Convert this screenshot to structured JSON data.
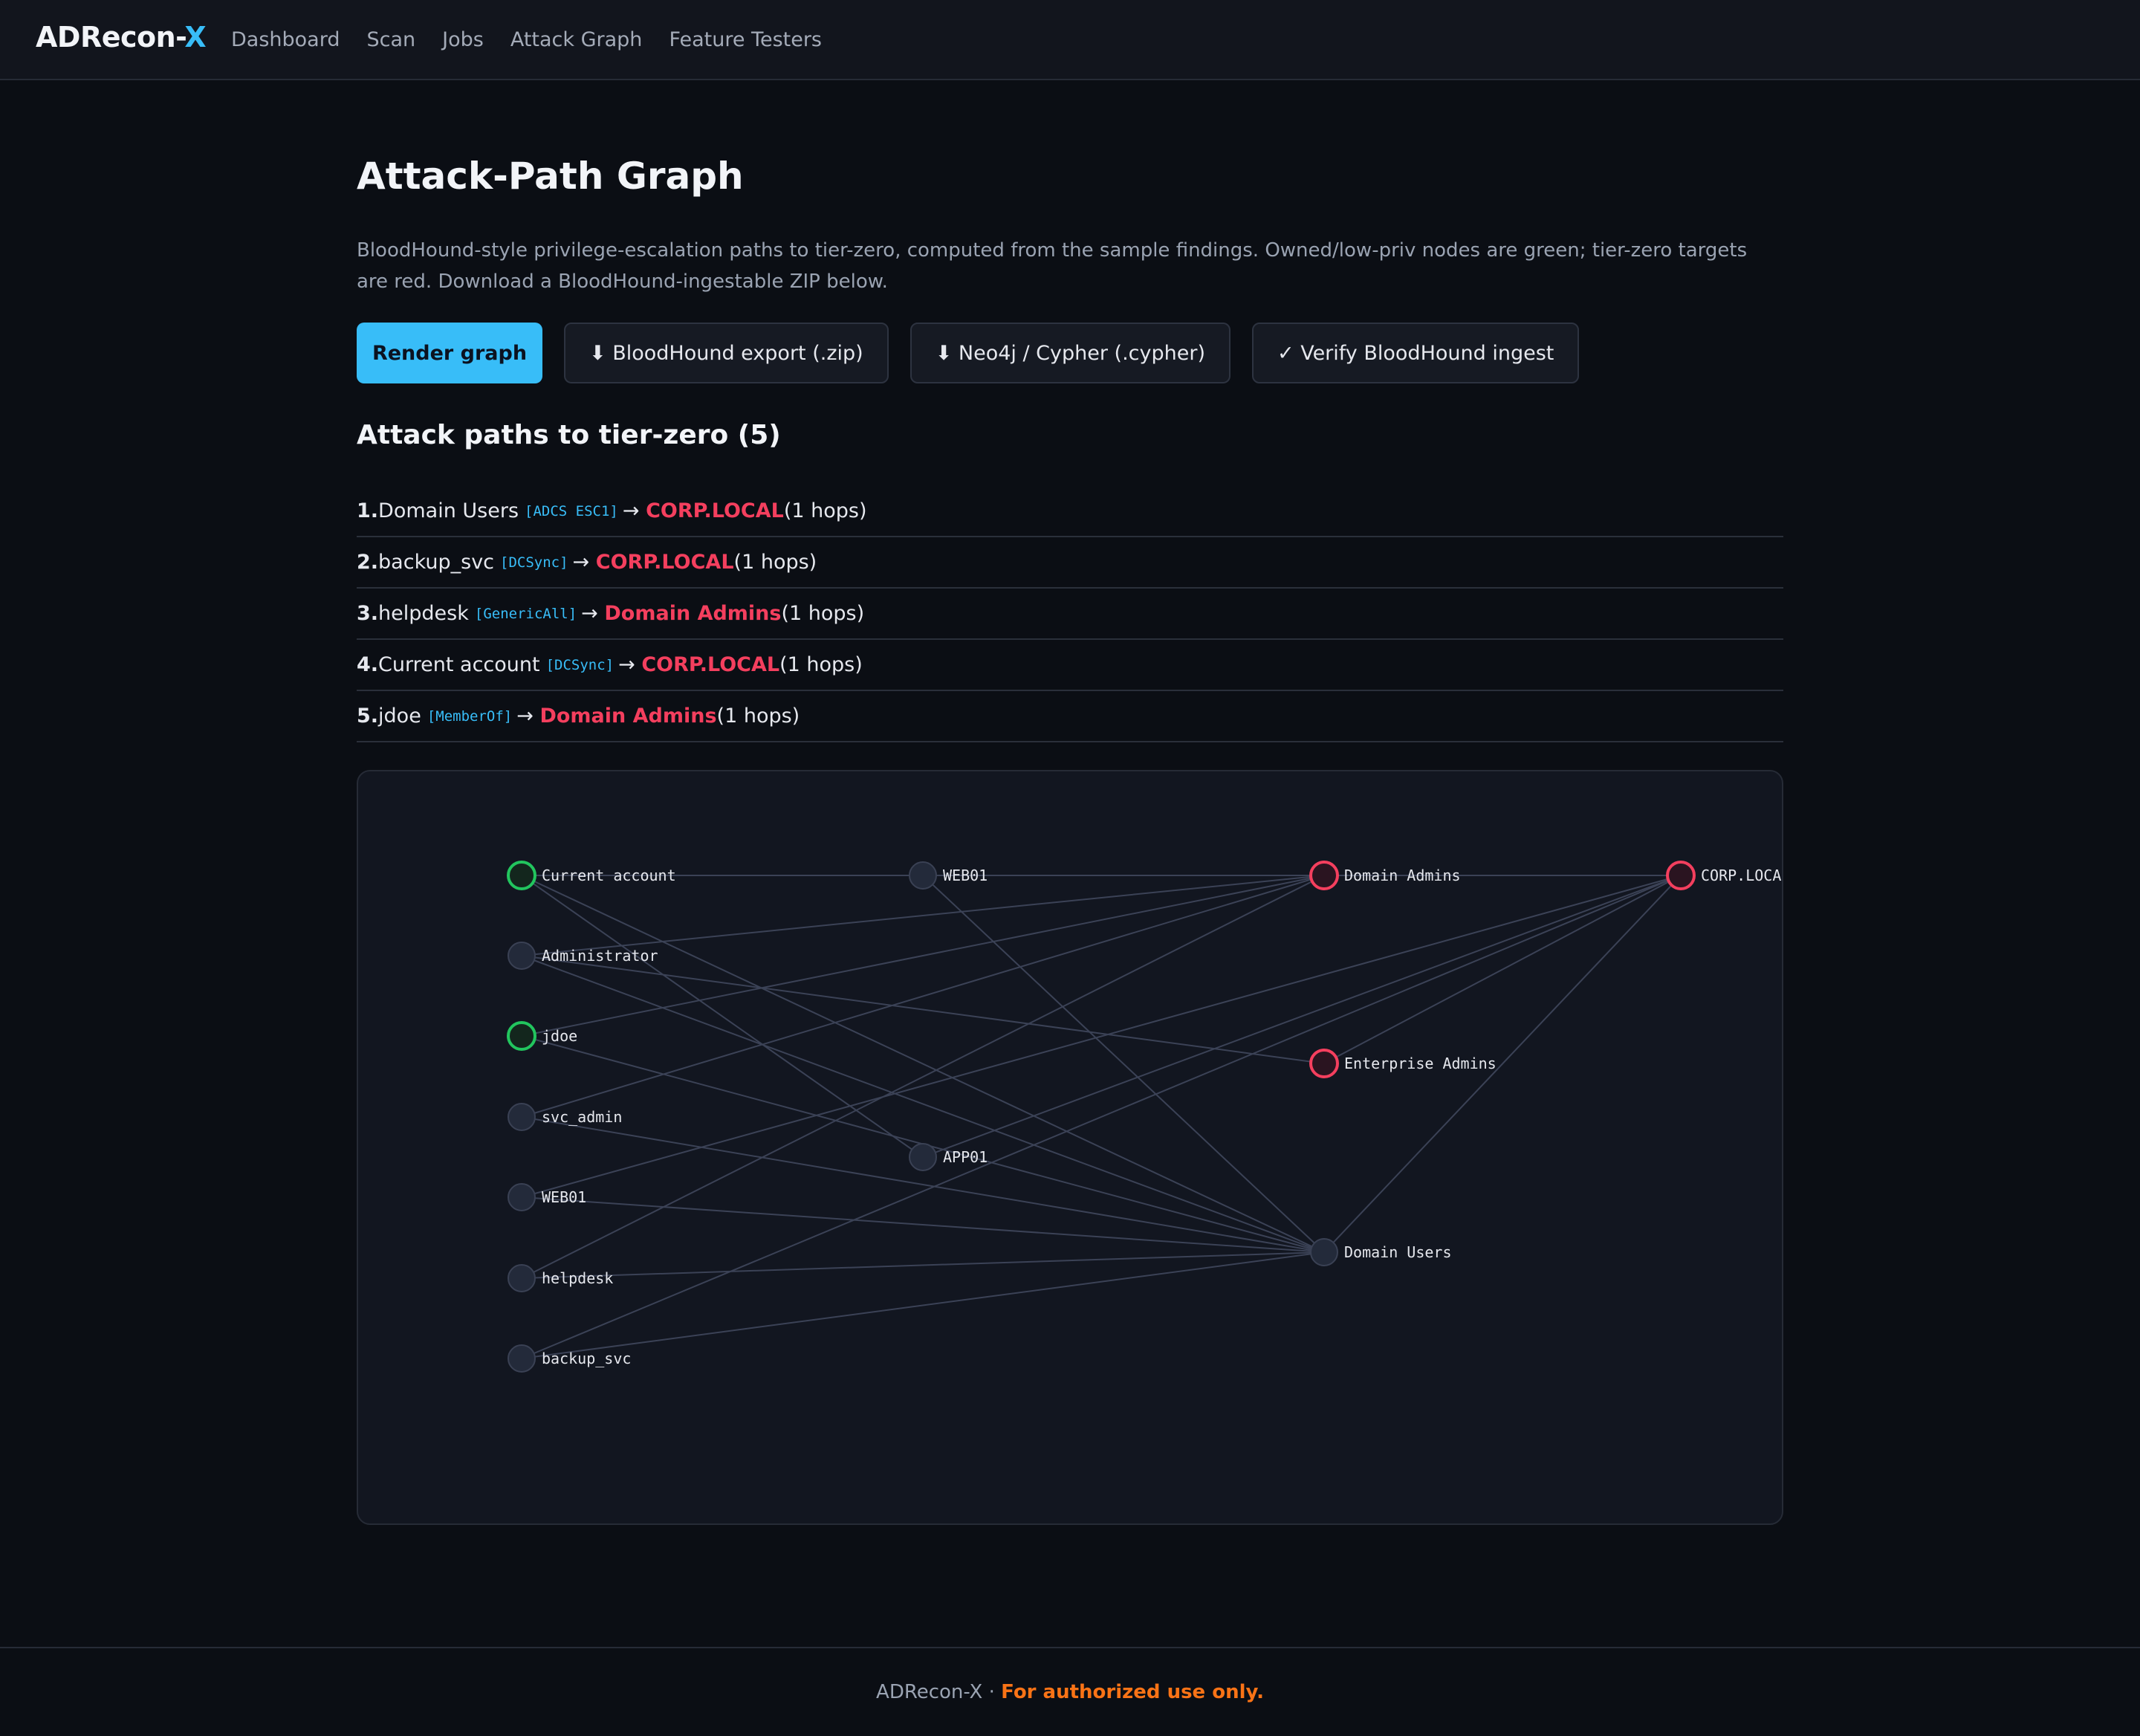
{
  "nav": {
    "brand_main": "ADRecon-",
    "brand_accent": "X",
    "links": [
      "Dashboard",
      "Scan",
      "Jobs",
      "Attack Graph",
      "Feature Testers"
    ]
  },
  "page": {
    "title": "Attack-Path Graph",
    "description": "BloodHound-style privilege-escalation paths to tier-zero, computed from the sample findings. Owned/low-priv nodes are green; tier-zero targets are red. Download a BloodHound-ingestable ZIP below."
  },
  "buttons": {
    "render": "Render graph",
    "bh_export": "⬇ BloodHound export (.zip)",
    "neo4j": "⬇ Neo4j / Cypher (.cypher)",
    "verify": "✓ Verify BloodHound ingest"
  },
  "paths": {
    "heading": "Attack paths to tier-zero (5)",
    "items": [
      {
        "num": "1.",
        "source": "Domain Users",
        "edge": "[ADCS ESC1]",
        "target": "CORP.LOCAL",
        "hops": "(1 hops)"
      },
      {
        "num": "2.",
        "source": "backup_svc",
        "edge": "[DCSync]",
        "target": "CORP.LOCAL",
        "hops": "(1 hops)"
      },
      {
        "num": "3.",
        "source": "helpdesk",
        "edge": "[GenericAll]",
        "target": "Domain Admins",
        "hops": "(1 hops)"
      },
      {
        "num": "4.",
        "source": "Current account",
        "edge": "[DCSync]",
        "target": "CORP.LOCAL",
        "hops": "(1 hops)"
      },
      {
        "num": "5.",
        "source": "jdoe",
        "edge": "[MemberOf]",
        "target": "Domain Admins",
        "hops": "(1 hops)"
      }
    ]
  },
  "graph": {
    "colors": {
      "owned": "#22c55e",
      "tier_zero": "#f43f5e",
      "neutral": "#3a4154",
      "edge": "#3b4256"
    },
    "nodes": [
      {
        "id": "cur",
        "label": "Current account",
        "kind": "owned"
      },
      {
        "id": "adm",
        "label": "Administrator",
        "kind": "neutral"
      },
      {
        "id": "jdoe",
        "label": "jdoe",
        "kind": "owned"
      },
      {
        "id": "svcadm",
        "label": "svc_admin",
        "kind": "neutral"
      },
      {
        "id": "web01a",
        "label": "WEB01",
        "kind": "neutral"
      },
      {
        "id": "help",
        "label": "helpdesk",
        "kind": "neutral"
      },
      {
        "id": "backup",
        "label": "backup_svc",
        "kind": "neutral"
      },
      {
        "id": "web01b",
        "label": "WEB01",
        "kind": "neutral"
      },
      {
        "id": "app01",
        "label": "APP01",
        "kind": "neutral"
      },
      {
        "id": "da",
        "label": "Domain Admins",
        "kind": "tier_zero"
      },
      {
        "id": "ea",
        "label": "Enterprise Admins",
        "kind": "tier_zero"
      },
      {
        "id": "du",
        "label": "Domain Users",
        "kind": "neutral"
      },
      {
        "id": "corp",
        "label": "CORP.LOCAL",
        "kind": "tier_zero"
      }
    ],
    "edges": [
      [
        "cur",
        "web01b"
      ],
      [
        "cur",
        "du"
      ],
      [
        "cur",
        "corp"
      ],
      [
        "cur",
        "app01"
      ],
      [
        "adm",
        "da"
      ],
      [
        "adm",
        "ea"
      ],
      [
        "adm",
        "du"
      ],
      [
        "jdoe",
        "da"
      ],
      [
        "jdoe",
        "du"
      ],
      [
        "svcadm",
        "da"
      ],
      [
        "svcadm",
        "du"
      ],
      [
        "web01a",
        "corp"
      ],
      [
        "web01a",
        "du"
      ],
      [
        "help",
        "da"
      ],
      [
        "help",
        "du"
      ],
      [
        "backup",
        "corp"
      ],
      [
        "backup",
        "du"
      ],
      [
        "web01b",
        "da"
      ],
      [
        "web01b",
        "du"
      ],
      [
        "app01",
        "corp"
      ],
      [
        "da",
        "corp"
      ],
      [
        "ea",
        "corp"
      ],
      [
        "du",
        "corp"
      ]
    ]
  },
  "footer": {
    "brand": "ADRecon-X · ",
    "warning": "For authorized use only."
  }
}
